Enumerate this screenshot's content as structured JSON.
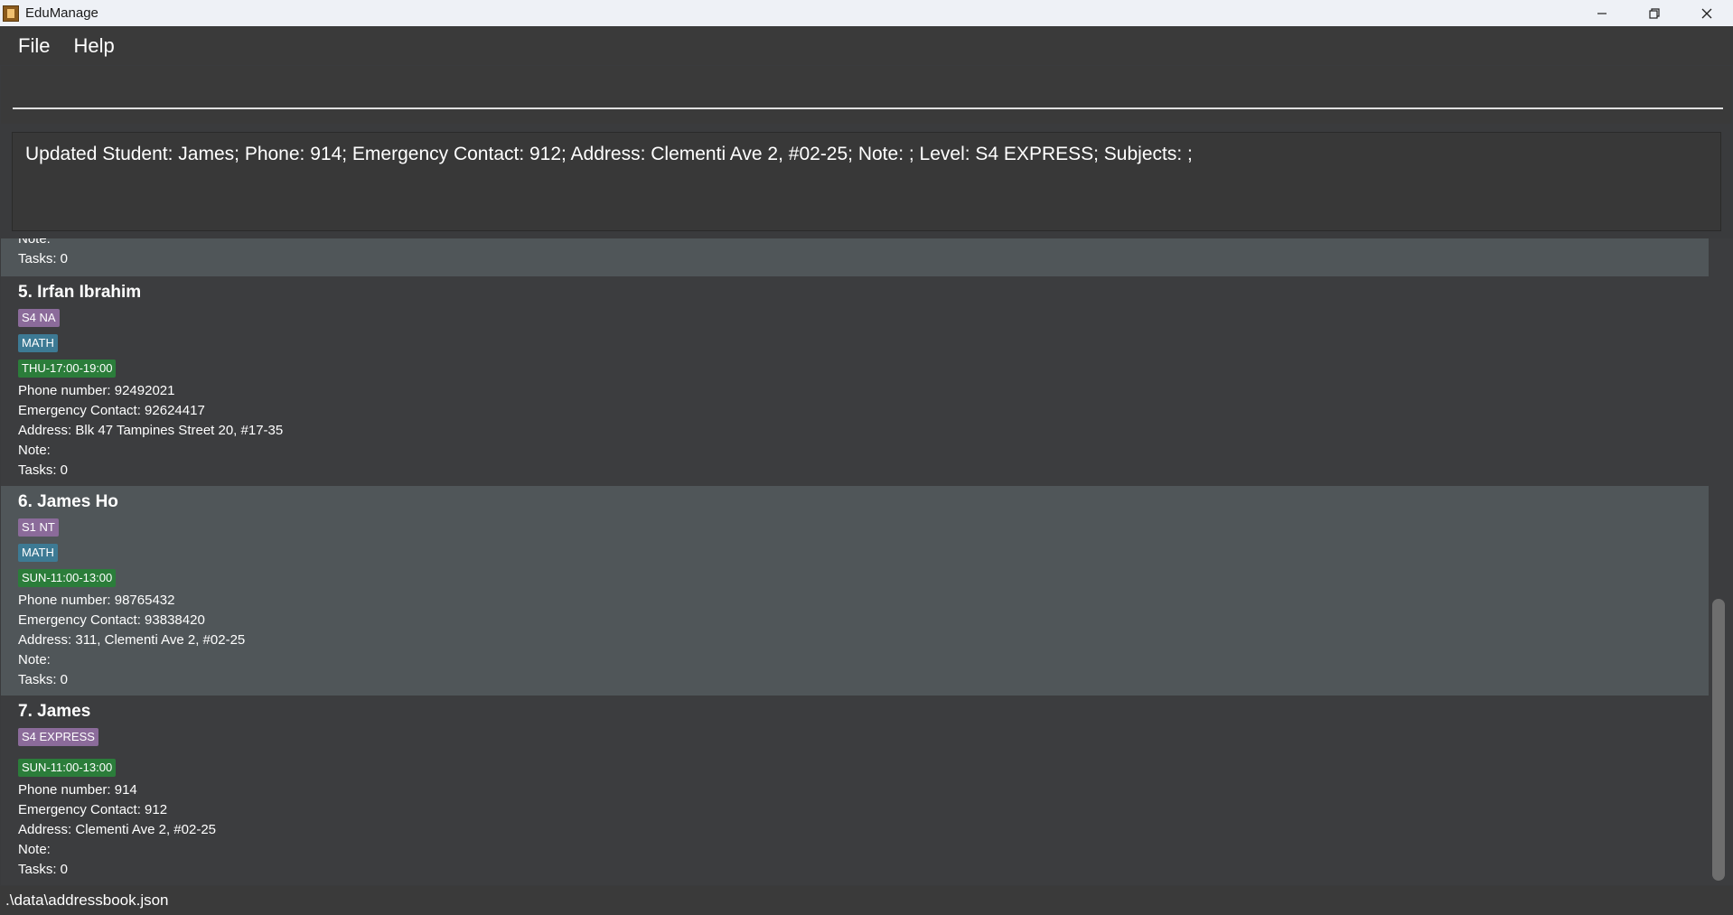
{
  "window": {
    "title": "EduManage"
  },
  "menu": {
    "file": "File",
    "help": "Help"
  },
  "command": {
    "value": ""
  },
  "result": {
    "text": "Updated Student: James; Phone: 914; Emergency Contact: 912; Address: Clementi Ave 2, #02-25; Note: ; Level: S4 EXPRESS; Subjects: ;"
  },
  "partial_card": {
    "note": "Note:",
    "tasks": "Tasks: 0"
  },
  "cards": [
    {
      "name": "5. Irfan Ibrahim",
      "level": "S4 NA",
      "subject": "MATH",
      "time": "THU-17:00-19:00",
      "phone": "Phone number: 92492021",
      "emergency": "Emergency Contact: 92624417",
      "address": "Address: Blk 47 Tampines Street 20, #17-35",
      "note": "Note:",
      "tasks": "Tasks: 0"
    },
    {
      "name": "6. James Ho",
      "level": "S1 NT",
      "subject": "MATH",
      "time": "SUN-11:00-13:00",
      "phone": "Phone number: 98765432",
      "emergency": "Emergency Contact: 93838420",
      "address": "Address: 311, Clementi Ave 2, #02-25",
      "note": "Note:",
      "tasks": "Tasks: 0"
    },
    {
      "name": "7. James",
      "level": "S4 EXPRESS",
      "subject": "",
      "time": "SUN-11:00-13:00",
      "phone": "Phone number: 914",
      "emergency": "Emergency Contact: 912",
      "address": "Address: Clementi Ave 2, #02-25",
      "note": "Note:",
      "tasks": "Tasks: 0"
    }
  ],
  "status": {
    "path": ".\\data\\addressbook.json"
  },
  "icons": [
    "app-icon",
    "minimize-icon",
    "maximize-icon",
    "close-icon"
  ],
  "colors": {
    "level_tag": "#8b6b9a",
    "subject_tag": "#3d7a94",
    "time_tag": "#2b7d3a",
    "selected_row": "#505659",
    "background": "#3a3b3d"
  }
}
